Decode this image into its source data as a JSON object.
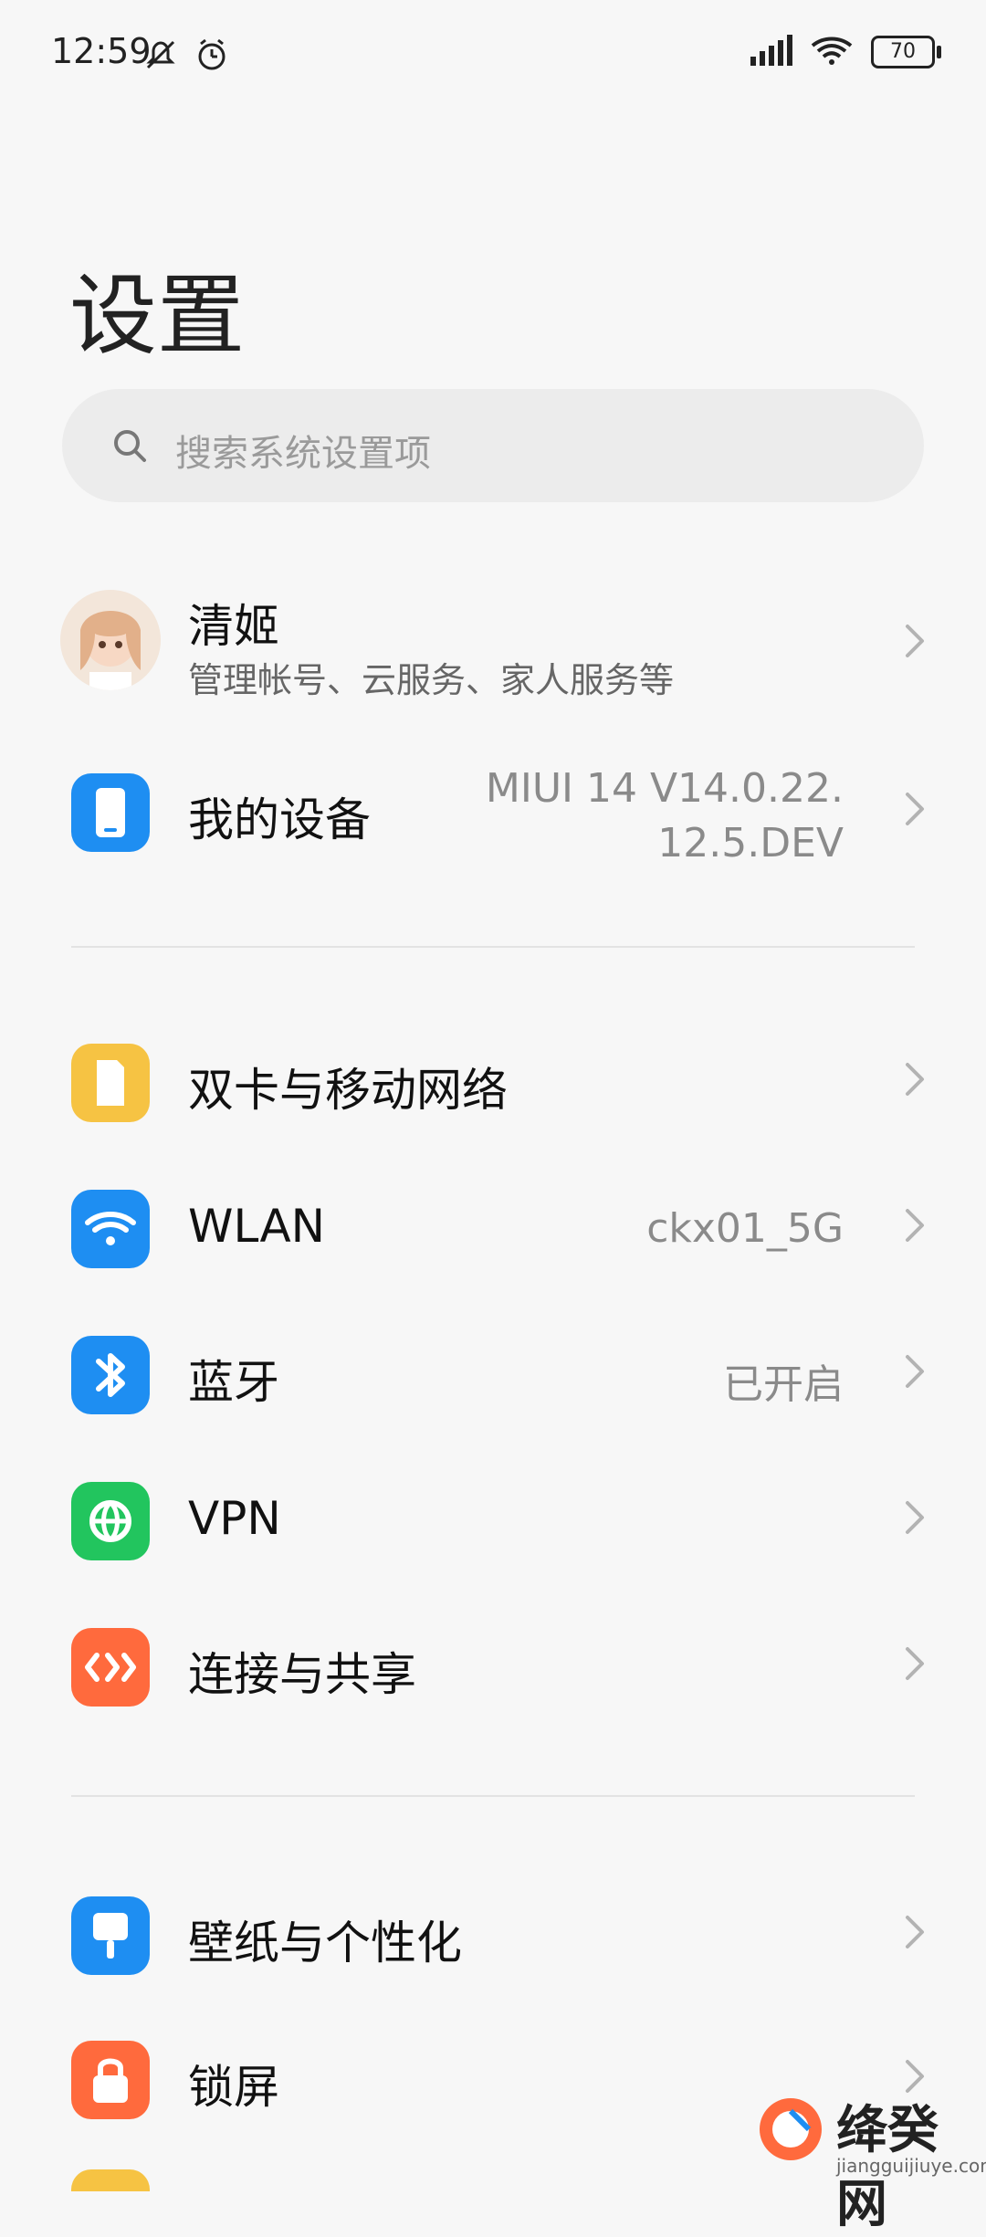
{
  "status_bar": {
    "time": "12:59",
    "battery": "70"
  },
  "title": "设置",
  "search": {
    "placeholder": "搜索系统设置项"
  },
  "account": {
    "name": "清姬",
    "subtitle": "管理帐号、云服务、家人服务等"
  },
  "device": {
    "label": "我的设备",
    "value_line1": "MIUI 14 V14.0.22.",
    "value_line2": "12.5.DEV"
  },
  "network": {
    "items": [
      {
        "label": "双卡与移动网络",
        "value": ""
      },
      {
        "label": "WLAN",
        "value": "ckx01_5G"
      },
      {
        "label": "蓝牙",
        "value": "已开启"
      },
      {
        "label": "VPN",
        "value": ""
      },
      {
        "label": "连接与共享",
        "value": ""
      }
    ]
  },
  "personal": {
    "items": [
      {
        "label": "壁纸与个性化",
        "value": ""
      },
      {
        "label": "锁屏",
        "value": ""
      }
    ]
  },
  "colors": {
    "blue": "#1e8ef2",
    "yellow": "#f6c343",
    "green": "#22c55e",
    "orange": "#ff6a3d"
  },
  "watermark": {
    "text": "绛癸网",
    "sub": "jiangguijiuye.com"
  }
}
